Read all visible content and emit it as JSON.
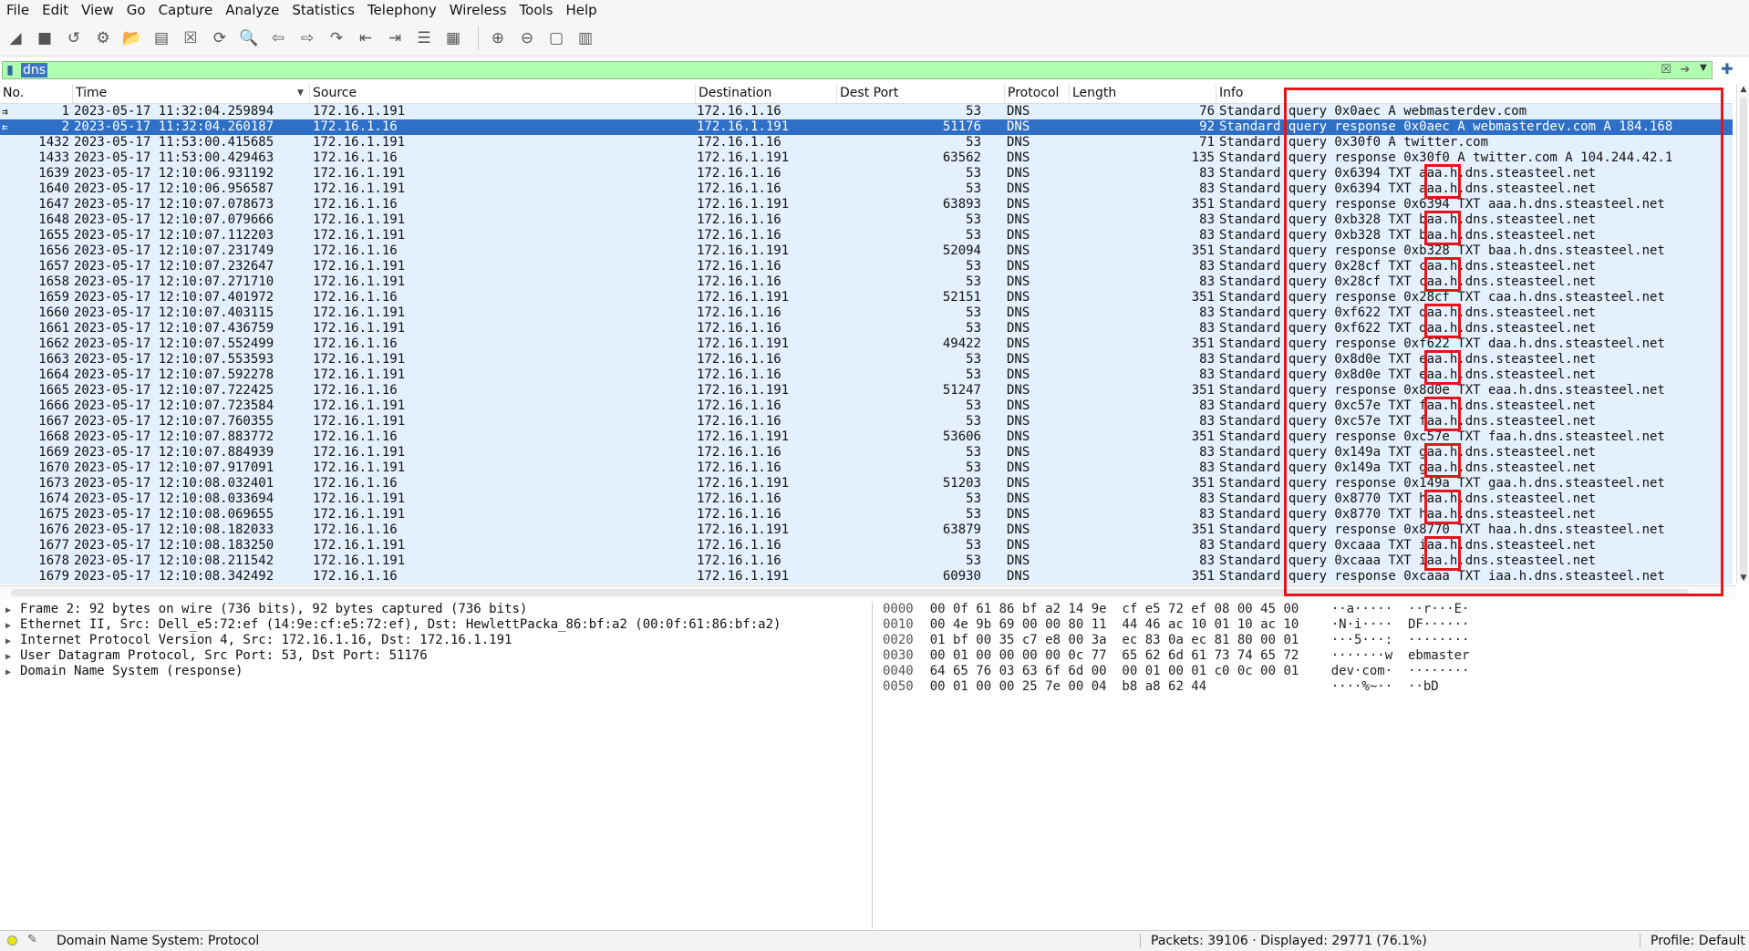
{
  "menu": [
    "File",
    "Edit",
    "View",
    "Go",
    "Capture",
    "Analyze",
    "Statistics",
    "Telephony",
    "Wireless",
    "Tools",
    "Help"
  ],
  "filter": {
    "value": "dns"
  },
  "columns": [
    "No.",
    "Time",
    "Source",
    "Destination",
    "Dest Port",
    "Protocol",
    "Length",
    "Info"
  ],
  "packets": [
    {
      "no": "1",
      "time": "2023-05-17 11:32:04.259894",
      "src": "172.16.1.191",
      "dst": "172.16.1.16",
      "dport": "53",
      "proto": "DNS",
      "len": "76",
      "info": "Standard query 0x0aec A webmasterdev.com"
    },
    {
      "no": "2",
      "time": "2023-05-17 11:32:04.260187",
      "src": "172.16.1.16",
      "dst": "172.16.1.191",
      "dport": "51176",
      "proto": "DNS",
      "len": "92",
      "info": "Standard query response 0x0aec A webmasterdev.com A 184.168"
    },
    {
      "no": "1432",
      "time": "2023-05-17 11:53:00.415685",
      "src": "172.16.1.191",
      "dst": "172.16.1.16",
      "dport": "53",
      "proto": "DNS",
      "len": "71",
      "info": "Standard query 0x30f0 A twitter.com"
    },
    {
      "no": "1433",
      "time": "2023-05-17 11:53:00.429463",
      "src": "172.16.1.16",
      "dst": "172.16.1.191",
      "dport": "63562",
      "proto": "DNS",
      "len": "135",
      "info": "Standard query response 0x30f0 A twitter.com A 104.244.42.1"
    },
    {
      "no": "1639",
      "time": "2023-05-17 12:10:06.931192",
      "src": "172.16.1.191",
      "dst": "172.16.1.16",
      "dport": "53",
      "proto": "DNS",
      "len": "83",
      "info": "Standard query 0x6394 TXT aaa.h.dns.steasteel.net"
    },
    {
      "no": "1640",
      "time": "2023-05-17 12:10:06.956587",
      "src": "172.16.1.191",
      "dst": "172.16.1.16",
      "dport": "53",
      "proto": "DNS",
      "len": "83",
      "info": "Standard query 0x6394 TXT aaa.h.dns.steasteel.net"
    },
    {
      "no": "1647",
      "time": "2023-05-17 12:10:07.078673",
      "src": "172.16.1.16",
      "dst": "172.16.1.191",
      "dport": "63893",
      "proto": "DNS",
      "len": "351",
      "info": "Standard query response 0x6394 TXT aaa.h.dns.steasteel.net"
    },
    {
      "no": "1648",
      "time": "2023-05-17 12:10:07.079666",
      "src": "172.16.1.191",
      "dst": "172.16.1.16",
      "dport": "53",
      "proto": "DNS",
      "len": "83",
      "info": "Standard query 0xb328 TXT baa.h.dns.steasteel.net"
    },
    {
      "no": "1655",
      "time": "2023-05-17 12:10:07.112203",
      "src": "172.16.1.191",
      "dst": "172.16.1.16",
      "dport": "53",
      "proto": "DNS",
      "len": "83",
      "info": "Standard query 0xb328 TXT baa.h.dns.steasteel.net"
    },
    {
      "no": "1656",
      "time": "2023-05-17 12:10:07.231749",
      "src": "172.16.1.16",
      "dst": "172.16.1.191",
      "dport": "52094",
      "proto": "DNS",
      "len": "351",
      "info": "Standard query response 0xb328 TXT baa.h.dns.steasteel.net"
    },
    {
      "no": "1657",
      "time": "2023-05-17 12:10:07.232647",
      "src": "172.16.1.191",
      "dst": "172.16.1.16",
      "dport": "53",
      "proto": "DNS",
      "len": "83",
      "info": "Standard query 0x28cf TXT caa.h.dns.steasteel.net"
    },
    {
      "no": "1658",
      "time": "2023-05-17 12:10:07.271710",
      "src": "172.16.1.191",
      "dst": "172.16.1.16",
      "dport": "53",
      "proto": "DNS",
      "len": "83",
      "info": "Standard query 0x28cf TXT caa.h.dns.steasteel.net"
    },
    {
      "no": "1659",
      "time": "2023-05-17 12:10:07.401972",
      "src": "172.16.1.16",
      "dst": "172.16.1.191",
      "dport": "52151",
      "proto": "DNS",
      "len": "351",
      "info": "Standard query response 0x28cf TXT caa.h.dns.steasteel.net"
    },
    {
      "no": "1660",
      "time": "2023-05-17 12:10:07.403115",
      "src": "172.16.1.191",
      "dst": "172.16.1.16",
      "dport": "53",
      "proto": "DNS",
      "len": "83",
      "info": "Standard query 0xf622 TXT daa.h.dns.steasteel.net"
    },
    {
      "no": "1661",
      "time": "2023-05-17 12:10:07.436759",
      "src": "172.16.1.191",
      "dst": "172.16.1.16",
      "dport": "53",
      "proto": "DNS",
      "len": "83",
      "info": "Standard query 0xf622 TXT daa.h.dns.steasteel.net"
    },
    {
      "no": "1662",
      "time": "2023-05-17 12:10:07.552499",
      "src": "172.16.1.16",
      "dst": "172.16.1.191",
      "dport": "49422",
      "proto": "DNS",
      "len": "351",
      "info": "Standard query response 0xf622 TXT daa.h.dns.steasteel.net"
    },
    {
      "no": "1663",
      "time": "2023-05-17 12:10:07.553593",
      "src": "172.16.1.191",
      "dst": "172.16.1.16",
      "dport": "53",
      "proto": "DNS",
      "len": "83",
      "info": "Standard query 0x8d0e TXT eaa.h.dns.steasteel.net"
    },
    {
      "no": "1664",
      "time": "2023-05-17 12:10:07.592278",
      "src": "172.16.1.191",
      "dst": "172.16.1.16",
      "dport": "53",
      "proto": "DNS",
      "len": "83",
      "info": "Standard query 0x8d0e TXT eaa.h.dns.steasteel.net"
    },
    {
      "no": "1665",
      "time": "2023-05-17 12:10:07.722425",
      "src": "172.16.1.16",
      "dst": "172.16.1.191",
      "dport": "51247",
      "proto": "DNS",
      "len": "351",
      "info": "Standard query response 0x8d0e TXT eaa.h.dns.steasteel.net"
    },
    {
      "no": "1666",
      "time": "2023-05-17 12:10:07.723584",
      "src": "172.16.1.191",
      "dst": "172.16.1.16",
      "dport": "53",
      "proto": "DNS",
      "len": "83",
      "info": "Standard query 0xc57e TXT faa.h.dns.steasteel.net"
    },
    {
      "no": "1667",
      "time": "2023-05-17 12:10:07.760355",
      "src": "172.16.1.191",
      "dst": "172.16.1.16",
      "dport": "53",
      "proto": "DNS",
      "len": "83",
      "info": "Standard query 0xc57e TXT faa.h.dns.steasteel.net"
    },
    {
      "no": "1668",
      "time": "2023-05-17 12:10:07.883772",
      "src": "172.16.1.16",
      "dst": "172.16.1.191",
      "dport": "53606",
      "proto": "DNS",
      "len": "351",
      "info": "Standard query response 0xc57e TXT faa.h.dns.steasteel.net"
    },
    {
      "no": "1669",
      "time": "2023-05-17 12:10:07.884939",
      "src": "172.16.1.191",
      "dst": "172.16.1.16",
      "dport": "53",
      "proto": "DNS",
      "len": "83",
      "info": "Standard query 0x149a TXT gaa.h.dns.steasteel.net"
    },
    {
      "no": "1670",
      "time": "2023-05-17 12:10:07.917091",
      "src": "172.16.1.191",
      "dst": "172.16.1.16",
      "dport": "53",
      "proto": "DNS",
      "len": "83",
      "info": "Standard query 0x149a TXT gaa.h.dns.steasteel.net"
    },
    {
      "no": "1673",
      "time": "2023-05-17 12:10:08.032401",
      "src": "172.16.1.16",
      "dst": "172.16.1.191",
      "dport": "51203",
      "proto": "DNS",
      "len": "351",
      "info": "Standard query response 0x149a TXT gaa.h.dns.steasteel.net"
    },
    {
      "no": "1674",
      "time": "2023-05-17 12:10:08.033694",
      "src": "172.16.1.191",
      "dst": "172.16.1.16",
      "dport": "53",
      "proto": "DNS",
      "len": "83",
      "info": "Standard query 0x8770 TXT haa.h.dns.steasteel.net"
    },
    {
      "no": "1675",
      "time": "2023-05-17 12:10:08.069655",
      "src": "172.16.1.191",
      "dst": "172.16.1.16",
      "dport": "53",
      "proto": "DNS",
      "len": "83",
      "info": "Standard query 0x8770 TXT haa.h.dns.steasteel.net"
    },
    {
      "no": "1676",
      "time": "2023-05-17 12:10:08.182033",
      "src": "172.16.1.16",
      "dst": "172.16.1.191",
      "dport": "63879",
      "proto": "DNS",
      "len": "351",
      "info": "Standard query response 0x8770 TXT haa.h.dns.steasteel.net"
    },
    {
      "no": "1677",
      "time": "2023-05-17 12:10:08.183250",
      "src": "172.16.1.191",
      "dst": "172.16.1.16",
      "dport": "53",
      "proto": "DNS",
      "len": "83",
      "info": "Standard query 0xcaaa TXT iaa.h.dns.steasteel.net"
    },
    {
      "no": "1678",
      "time": "2023-05-17 12:10:08.211542",
      "src": "172.16.1.191",
      "dst": "172.16.1.16",
      "dport": "53",
      "proto": "DNS",
      "len": "83",
      "info": "Standard query 0xcaaa TXT iaa.h.dns.steasteel.net"
    },
    {
      "no": "1679",
      "time": "2023-05-17 12:10:08.342492",
      "src": "172.16.1.16",
      "dst": "172.16.1.191",
      "dport": "60930",
      "proto": "DNS",
      "len": "351",
      "info": "Standard query response 0xcaaa TXT iaa.h.dns.steasteel.net"
    }
  ],
  "selected_row": 1,
  "details": [
    "Frame 2: 92 bytes on wire (736 bits), 92 bytes captured (736 bits)",
    "Ethernet II, Src: Dell_e5:72:ef (14:9e:cf:e5:72:ef), Dst: HewlettPacka_86:bf:a2 (00:0f:61:86:bf:a2)",
    "Internet Protocol Version 4, Src: 172.16.1.16, Dst: 172.16.1.191",
    "User Datagram Protocol, Src Port: 53, Dst Port: 51176",
    "Domain Name System (response)"
  ],
  "bytes": [
    {
      "offset": "0000",
      "hex": "00 0f 61 86 bf a2 14 9e  cf e5 72 ef 08 00 45 00",
      "ascii": "··a·····  ··r···E·"
    },
    {
      "offset": "0010",
      "hex": "00 4e 9b 69 00 00 80 11  44 46 ac 10 01 10 ac 10",
      "ascii": "·N·i····  DF······"
    },
    {
      "offset": "0020",
      "hex": "01 bf 00 35 c7 e8 00 3a  ec 83 0a ec 81 80 00 01",
      "ascii": "···5···:  ········"
    },
    {
      "offset": "0030",
      "hex": "00 01 00 00 00 00 0c 77  65 62 6d 61 73 74 65 72",
      "ascii": "·······w  ebmaster"
    },
    {
      "offset": "0040",
      "hex": "64 65 76 03 63 6f 6d 00  00 01 00 01 c0 0c 00 01",
      "ascii": "dev·com·  ········"
    },
    {
      "offset": "0050",
      "hex": "00 01 00 00 25 7e 00 04  b8 a8 62 44",
      "ascii": "····%~··  ··bD"
    }
  ],
  "status": {
    "left": "Domain Name System: Protocol",
    "packets": "Packets: 39106 · Displayed: 29771 (76.1%)",
    "profile": "Profile: Default"
  },
  "colors": {
    "selected": "#2f6fc6",
    "row": "#e4f0fd",
    "filter_ok": "#afffaf",
    "annotation": "#e8141b"
  }
}
